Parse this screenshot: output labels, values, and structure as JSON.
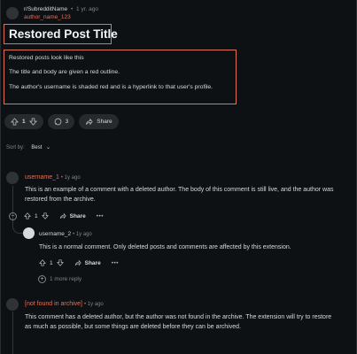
{
  "post": {
    "subreddit": "r/SubredditName",
    "time": "1 yr. ago",
    "author": "author_name_123",
    "title": "Restored Post Title",
    "body": [
      "Restored posts look like this",
      "The title and body are given a red outline.",
      "The author's username is shaded red  and is a hyperlink to that user's profile."
    ],
    "vote_count": "1",
    "comment_count": "3",
    "share_label": "Share"
  },
  "sort": {
    "label": "Sort by:",
    "value": "Best"
  },
  "comments": [
    {
      "author": "username_1",
      "time": "1y ago",
      "body": "This is an example of a comment with a deleted author. The body of this comment is still live, and the author was restored from the archive.",
      "votes": "1",
      "share_label": "Share"
    },
    {
      "author": "username_2",
      "time": "1y ago",
      "body": "This is a normal comment. Only deleted posts and comments are affected by this extension.",
      "votes": "1",
      "share_label": "Share",
      "more_replies": "1 more reply"
    },
    {
      "author": "[not found in archive]",
      "time": "1y ago",
      "body": "This comment has a deleted author, but the author was not found in the archive. The extension will try to restore as much as possible, but some things are deleted before they can be archived."
    }
  ],
  "colors": {
    "accent": "#e0715b",
    "background": "#0e1113",
    "pill": "#272a2d"
  }
}
